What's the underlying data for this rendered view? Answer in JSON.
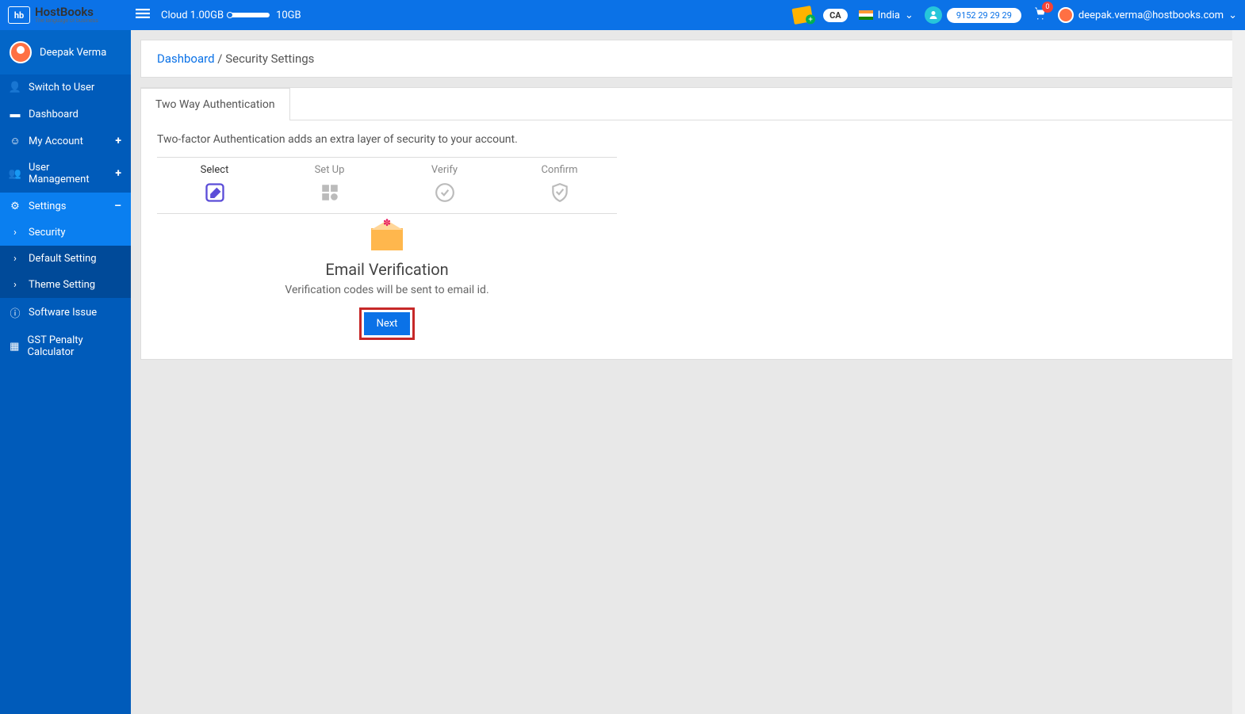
{
  "header": {
    "logo_main": "HostBooks",
    "logo_sub": "The language of business",
    "logo_badge": "hb",
    "cloud_label": "Cloud 1.00GB",
    "cloud_max": "10GB",
    "ca_badge": "CA",
    "country": "India",
    "phone": "9152 29 29 29",
    "cart_count": "0",
    "user_email": "deepak.verma@hostbooks.com"
  },
  "sidebar": {
    "user_name": "Deepak Verma",
    "items": [
      {
        "label": "Switch to User",
        "icon": "user"
      },
      {
        "label": "Dashboard",
        "icon": "dashboard"
      },
      {
        "label": "My Account",
        "icon": "account",
        "expand": "+"
      },
      {
        "label": "User Management",
        "icon": "users",
        "expand": "+"
      },
      {
        "label": "Settings",
        "icon": "gear",
        "expand": "–"
      },
      {
        "label": "Security",
        "icon": "chevron",
        "sub": true,
        "active": true
      },
      {
        "label": "Default Setting",
        "icon": "chevron",
        "sub": true
      },
      {
        "label": "Theme Setting",
        "icon": "chevron",
        "sub": true
      },
      {
        "label": "Software Issue",
        "icon": "info"
      },
      {
        "label": "GST Penalty Calculator",
        "icon": "calc"
      }
    ]
  },
  "breadcrumb": {
    "link": "Dashboard",
    "current": "Security Settings"
  },
  "panel": {
    "tab": "Two Way Authentication",
    "description": "Two-factor Authentication adds an extra layer of security to your account.",
    "steps": [
      {
        "label": "Select",
        "icon": "edit",
        "active": true
      },
      {
        "label": "Set Up",
        "icon": "grid"
      },
      {
        "label": "Verify",
        "icon": "check"
      },
      {
        "label": "Confirm",
        "icon": "shield"
      }
    ],
    "verify_title": "Email Verification",
    "verify_desc": "Verification codes will be sent to email id.",
    "next_button": "Next"
  }
}
